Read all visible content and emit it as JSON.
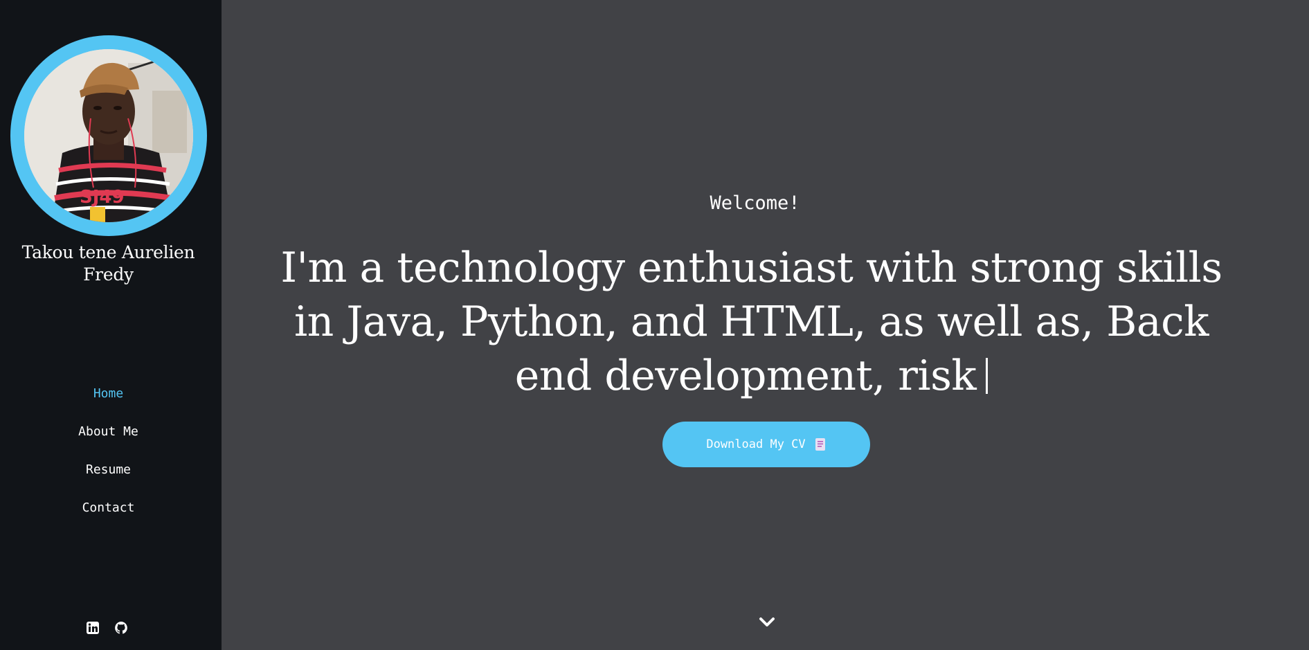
{
  "profile": {
    "name": "Takou tene Aurelien Fredy"
  },
  "nav": {
    "items": [
      {
        "label": "Home",
        "active": true
      },
      {
        "label": "About Me",
        "active": false
      },
      {
        "label": "Resume",
        "active": false
      },
      {
        "label": "Contact",
        "active": false
      }
    ]
  },
  "social": {
    "icons": [
      "linkedin-icon",
      "github-icon"
    ]
  },
  "hero": {
    "welcome": "Welcome!",
    "headline": "I'm a technology enthusiast with strong skills in Java, Python, and HTML, as well as, Back end development, risk",
    "cta_label": "Download My CV",
    "cta_icon": "document-icon",
    "scroll_icon": "chevron-down-icon"
  },
  "colors": {
    "accent": "#54c5f3",
    "sidebar_bg": "#111418",
    "main_bg": "#414246",
    "text": "#ffffff"
  }
}
